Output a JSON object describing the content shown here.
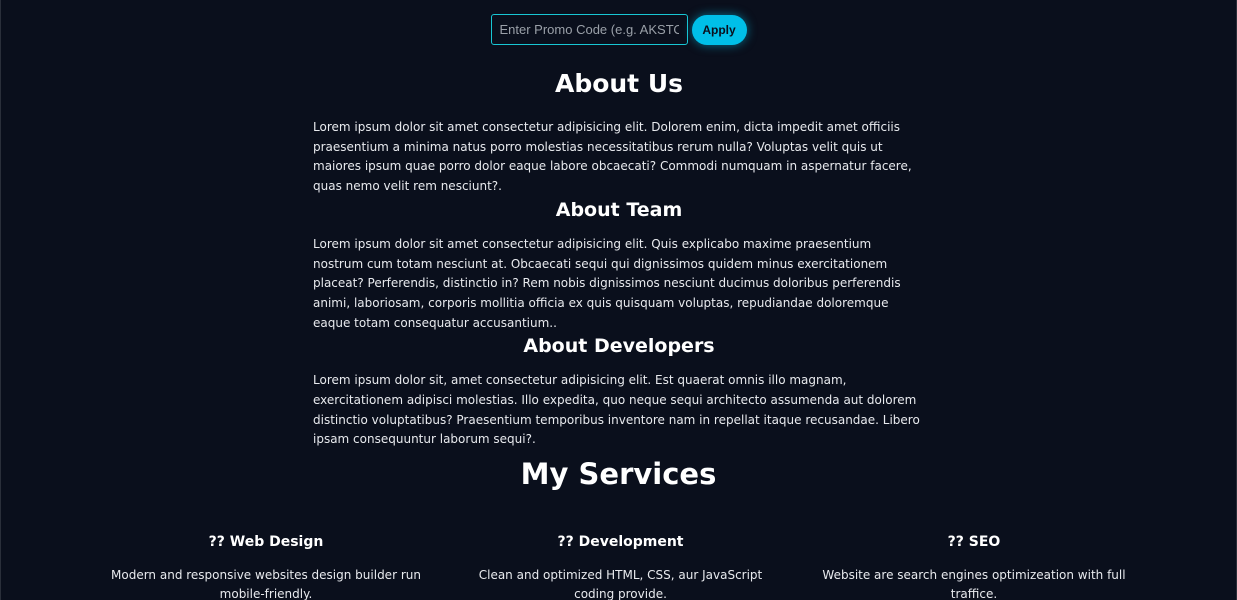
{
  "promo": {
    "placeholder": "Enter Promo Code (e.g. AKSTOF",
    "apply_label": "Apply"
  },
  "about": {
    "title": "About Us",
    "text": "Lorem ipsum dolor sit amet consectetur adipisicing elit. Dolorem enim, dicta impedit amet officiis praesentium a minima natus porro molestias necessitatibus rerum nulla? Voluptas velit quis ut maiores ipsum quae porro dolor eaque labore obcaecati? Commodi numquam in aspernatur facere, quas nemo velit rem nesciunt?.",
    "team_title": "About Team",
    "team_text": "Lorem ipsum dolor sit amet consectetur adipisicing elit. Quis explicabo maxime praesentium nostrum cum totam nesciunt at. Obcaecati sequi qui dignissimos quidem minus exercitationem placeat? Perferendis, distinctio in? Rem nobis dignissimos nesciunt ducimus doloribus perferendis animi, laboriosam, corporis mollitia officia ex quis quisquam voluptas, repudiandae doloremque eaque totam consequatur accusantium..",
    "dev_title": "About Developers",
    "dev_text": "Lorem ipsum dolor sit, amet consectetur adipisicing elit. Est quaerat omnis illo magnam, exercitationem adipisci molestias. Illo expedita, quo neque sequi architecto assumenda aut dolorem distinctio voluptatibus? Praesentium temporibus inventore nam in repellat itaque recusandae. Libero ipsam consequuntur laborum sequi?."
  },
  "services": {
    "title": "My Services",
    "items": [
      {
        "title": "?? Web Design",
        "text": "Modern and responsive websites design builder run mobile-friendly."
      },
      {
        "title": "?? Development",
        "text": "Clean and optimized HTML, CSS, aur JavaScript coding provide."
      },
      {
        "title": "?? SEO",
        "text": "Website are search engines optimizeation with full traffice."
      }
    ]
  },
  "colors": {
    "background": "#0a0f1c",
    "accent": "#00bfe8",
    "input_border": "#18c6d4"
  }
}
